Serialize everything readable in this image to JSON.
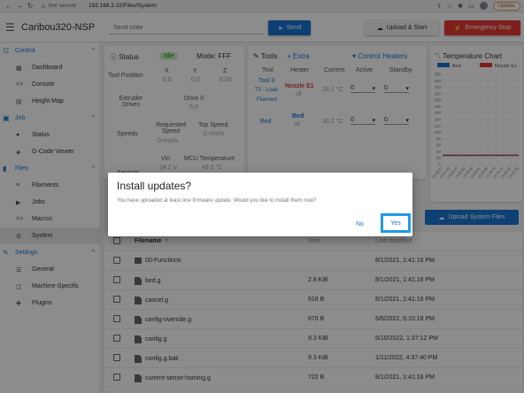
{
  "browser": {
    "back": "←",
    "forward": "→",
    "reload": "↻",
    "security": "Not secure",
    "url": "192.168.3.22/Files/System",
    "update": "Update"
  },
  "app": {
    "title": "Caribou320-NSP",
    "code_placeholder": "Send code",
    "send_label": "Send",
    "upload_label": "Upload & Start",
    "estop_label": "Emergency Stop"
  },
  "sidebar": {
    "groups": [
      {
        "label": "Control",
        "items": [
          "Dashboard",
          "Console",
          "Height Map"
        ]
      },
      {
        "label": "Job",
        "items": [
          "Status",
          "G-Code Viewer"
        ]
      },
      {
        "label": "Files",
        "items": [
          "Filaments",
          "Jobs",
          "Macros",
          "System"
        ]
      },
      {
        "label": "Settings",
        "items": [
          "General",
          "Machine-Specific",
          "Plugins"
        ]
      }
    ],
    "active_item": "System"
  },
  "status": {
    "title": "Status",
    "state": "Idle",
    "mode": "Mode: FFF",
    "tool_position": "Tool Position",
    "axes": [
      "X",
      "Y",
      "Z"
    ],
    "axis_values": [
      "0.0",
      "0.0",
      "0.00"
    ],
    "extruder_drives": "Extruder Drives",
    "drive0": "Drive 0",
    "drive0_value": "0.0",
    "speeds": "Speeds",
    "requested_speed": "Requested Speed",
    "requested_value": "0 mm/s",
    "top_speed": "Top Speed",
    "top_value": "0 mm/s",
    "sensors": "Sensors",
    "vin": "Vin",
    "vin_value": "24.2 V",
    "mcu": "MCU Temperature",
    "mcu_value": "49.1 °C"
  },
  "tools": {
    "title": "Tools",
    "extra": "Extra",
    "control_heaters": "Control Heaters",
    "headers": [
      "Tool",
      "Heater",
      "Current",
      "Active",
      "Standby"
    ],
    "tool0_name": "Tool 0",
    "tool0_sub": "T0 - Load",
    "tool0_sub2": "Filament",
    "tool0_heater": "Nozzle E1",
    "tool0_state": "off",
    "tool0_current": "28.1 °C",
    "bed_name": "Bed",
    "bed_heater": "Bed",
    "bed_state": "off",
    "bed_current": "30.2 °C",
    "active_value": "0",
    "standby_value": "0"
  },
  "chart": {
    "title": "Temperature Chart",
    "legend": [
      "Bed",
      "Nozzle E1"
    ],
    "colors": {
      "bed": "#1976d2",
      "nozzle": "#e53935"
    }
  },
  "chart_data": {
    "type": "line",
    "title": "Temperature Chart",
    "ylim": [
      0,
      280
    ],
    "y_ticks": [
      "280",
      "260",
      "240",
      "220",
      "200",
      "180",
      "160",
      "140",
      "120",
      "100",
      "80",
      "60",
      "40",
      "20",
      "0"
    ],
    "x": [
      "13:26:37",
      "13:27:43",
      "13:28:47",
      "13:29:52",
      "13:30:56",
      "13:32:01",
      "13:33:05",
      "13:34:10",
      "13:35:14",
      "13:36:19",
      "13:37:25"
    ],
    "series": [
      {
        "name": "Bed",
        "values": [
          30,
          30,
          30,
          30,
          30,
          30,
          30,
          30,
          30,
          30,
          30
        ]
      },
      {
        "name": "Nozzle E1",
        "values": [
          28,
          28,
          28,
          28,
          28,
          28,
          28,
          28,
          28,
          28,
          28
        ]
      }
    ]
  },
  "files": {
    "upload_system": "Upload System Files",
    "headers": [
      "Filename",
      "Size",
      "Last modified"
    ],
    "rows": [
      {
        "type": "folder",
        "name": "00-Functions",
        "size": "",
        "date": "8/1/2021, 1:41:16 PM"
      },
      {
        "type": "file",
        "name": "bed.g",
        "size": "2.8 KiB",
        "date": "8/1/2021, 1:41:16 PM"
      },
      {
        "type": "file",
        "name": "cancel.g",
        "size": "618 B",
        "date": "8/1/2021, 1:41:16 PM"
      },
      {
        "type": "file",
        "name": "config-override.g",
        "size": "670 B",
        "date": "5/6/2022, 6:10:18 PM"
      },
      {
        "type": "file",
        "name": "config.g",
        "size": "9.3 KiB",
        "date": "5/10/2022, 1:37:12 PM"
      },
      {
        "type": "file",
        "name": "config.g.bak",
        "size": "9.3 KiB",
        "date": "1/11/2022, 4:37:40 PM"
      },
      {
        "type": "file",
        "name": "current-sense-homing.g",
        "size": "722 B",
        "date": "8/1/2021, 1:41:16 PM"
      }
    ]
  },
  "dialog": {
    "title": "Install updates?",
    "text": "You have uploaded at least one firmware update. Would you like to install them now?",
    "no_label": "No",
    "yes_label": "Yes"
  }
}
